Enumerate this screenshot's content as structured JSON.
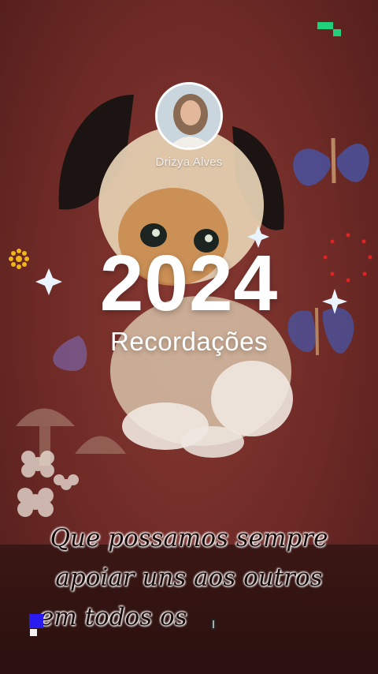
{
  "author": {
    "name": "Drizya Alves"
  },
  "title": {
    "year": "2024",
    "subtitle": "Recordações"
  },
  "caption": {
    "line1": "Que possamos sempre",
    "line2": "apoiar uns aos outros",
    "line3": "em todos os"
  },
  "colors": {
    "background": "#6e2a26",
    "text_primary": "#ffffff",
    "caption_text": "#1a0c0b",
    "indicator_green": "#21d07a",
    "indicator_blue": "#2a1cf0"
  },
  "icons": [
    "avatar-photo",
    "sparkle-icon",
    "butterfly-icon",
    "flower-icon",
    "puppy-illustration"
  ]
}
